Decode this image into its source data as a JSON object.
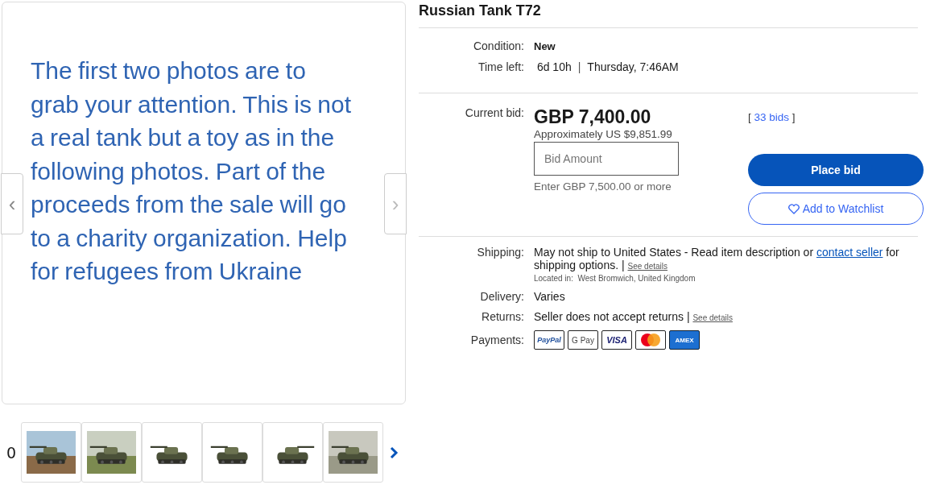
{
  "gallery": {
    "image_text": "The first two photos are to grab your attention.  This is not a real tank but a toy as in the following photos. Part of the proceeds from the sale will go to a charity organization.  Help for refugees from Ukraine",
    "prev": "‹",
    "next": "›"
  },
  "thumbnails": {
    "counter": "0"
  },
  "title": "Russian Tank T72",
  "condition": {
    "label": "Condition:",
    "value": "New"
  },
  "time_left": {
    "label": "Time left:",
    "remaining": "6d 10h",
    "separator": "|",
    "end": "Thursday, 7:46AM"
  },
  "bid": {
    "label": "Current bid:",
    "price": "GBP 7,400.00",
    "approx": "Approximately US $9,851.99",
    "bids_open": "[",
    "bids": "33 bids",
    "bids_close": "]",
    "placeholder": "Bid Amount",
    "hint": "Enter GBP 7,500.00 or more",
    "place_bid": "Place bid",
    "watchlist": "Add to Watchlist"
  },
  "shipping": {
    "label": "Shipping:",
    "text": "May not ship to United States - Read item description or",
    "link": "contact seller",
    "text_after": "for shipping options.",
    "separator": "|",
    "details": "See details",
    "location_label": "Located in:",
    "location": "West Bromwich, United Kingdom"
  },
  "delivery": {
    "label": "Delivery:",
    "value": "Varies"
  },
  "returns": {
    "label": "Returns:",
    "value": "Seller does not accept returns",
    "separator": "|",
    "details": "See details"
  },
  "payments": {
    "label": "Payments:",
    "methods": [
      {
        "kind": "paypal",
        "label": "PayPal"
      },
      {
        "kind": "gpay",
        "label": "G Pay"
      },
      {
        "kind": "visa",
        "label": "VISA"
      },
      {
        "kind": "mastercard"
      },
      {
        "kind": "amex",
        "label": "AMEX"
      }
    ]
  }
}
